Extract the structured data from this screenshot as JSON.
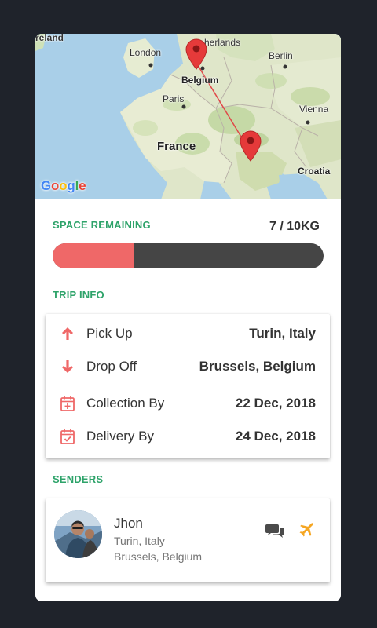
{
  "map": {
    "labels": {
      "ireland": "reland",
      "netherlands": "herlands",
      "london": "London",
      "berlin": "Berlin",
      "belgium": "Belgium",
      "paris": "Paris",
      "france": "France",
      "vienna": "Vienna",
      "croatia": "Croatia"
    },
    "logo": [
      "G",
      "o",
      "o",
      "g",
      "l",
      "e"
    ]
  },
  "space": {
    "title": "SPACE REMAINING",
    "used": 3,
    "capacity_text": "7 / 10KG",
    "used_fraction": 0.3,
    "fill_color": "#ef6868",
    "track_color": "#454545"
  },
  "trip": {
    "title": "TRIP INFO",
    "rows": [
      {
        "icon": "arrow-up-icon",
        "label": "Pick Up",
        "value": "Turin, Italy"
      },
      {
        "icon": "arrow-down-icon",
        "label": "Drop Off",
        "value": "Brussels, Belgium"
      },
      {
        "icon": "calendar-plus-icon",
        "label": "Collection By",
        "value": "22 Dec, 2018"
      },
      {
        "icon": "calendar-check-icon",
        "label": "Delivery By",
        "value": "24 Dec, 2018"
      }
    ]
  },
  "senders": {
    "title": "SENDERS",
    "items": [
      {
        "name": "Jhon",
        "from": "Turin, Italy",
        "to": "Brussels, Belgium"
      }
    ]
  },
  "colors": {
    "accent": "#2ea36a",
    "icon": "#ef6868",
    "plane": "#f5a623",
    "chat": "#4a4a4a"
  }
}
